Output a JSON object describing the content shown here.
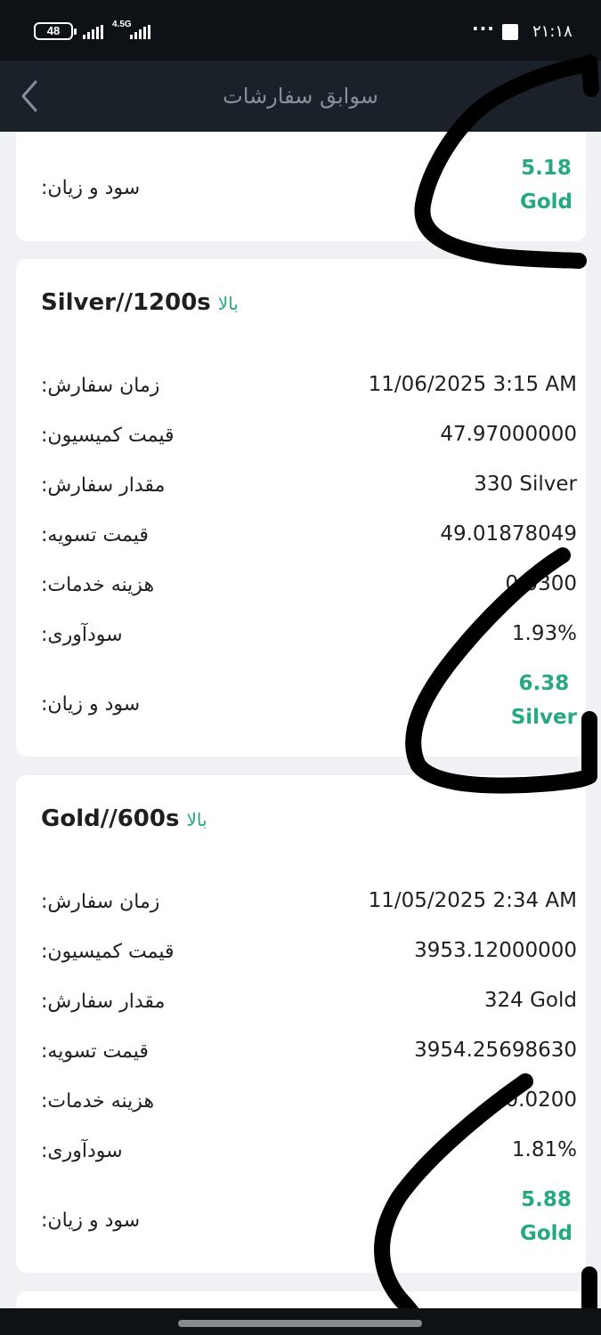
{
  "status_bar": {
    "battery": "48",
    "network": "4.5G",
    "dots": "···",
    "time": "۲۱:۱۸"
  },
  "header": {
    "title": "سوابق سفارشات"
  },
  "orders": [
    {
      "pnl_label": "سود و زیان:",
      "pnl_value": "5.18",
      "pnl_unit": "Gold"
    },
    {
      "symbol": "Silver//1200s",
      "direction": "بالا",
      "rows": [
        {
          "label": "زمان سفارش:",
          "value": "11/06/2025 3:15 AM"
        },
        {
          "label": "قیمت کمیسیون:",
          "value": "47.97000000"
        },
        {
          "label": "مقدار سفارش:",
          "value": "330 Silver"
        },
        {
          "label": "قیمت تسویه:",
          "value": "49.01878049"
        },
        {
          "label": "هزینه خدمات:",
          "value": "0.0300"
        },
        {
          "label": "سودآوری:",
          "value": "1.93%"
        }
      ],
      "pnl_label": "سود و زیان:",
      "pnl_value": "6.38",
      "pnl_unit": "Silver"
    },
    {
      "symbol": "Gold//600s",
      "direction": "بالا",
      "rows": [
        {
          "label": "زمان سفارش:",
          "value": "11/05/2025 2:34 AM"
        },
        {
          "label": "قیمت کمیسیون:",
          "value": "3953.12000000"
        },
        {
          "label": "مقدار سفارش:",
          "value": "324 Gold"
        },
        {
          "label": "قیمت تسویه:",
          "value": "3954.25698630"
        },
        {
          "label": "هزینه خدمات:",
          "value": "0.0200"
        },
        {
          "label": "سودآوری:",
          "value": "1.81%"
        }
      ],
      "pnl_label": "سود و زیان:",
      "pnl_value": "5.88",
      "pnl_unit": "Gold"
    }
  ],
  "colors": {
    "accent_green": "#27a883",
    "header_bg": "#1b2129",
    "status_bg": "#0e1217",
    "page_bg": "#eff1f4"
  }
}
